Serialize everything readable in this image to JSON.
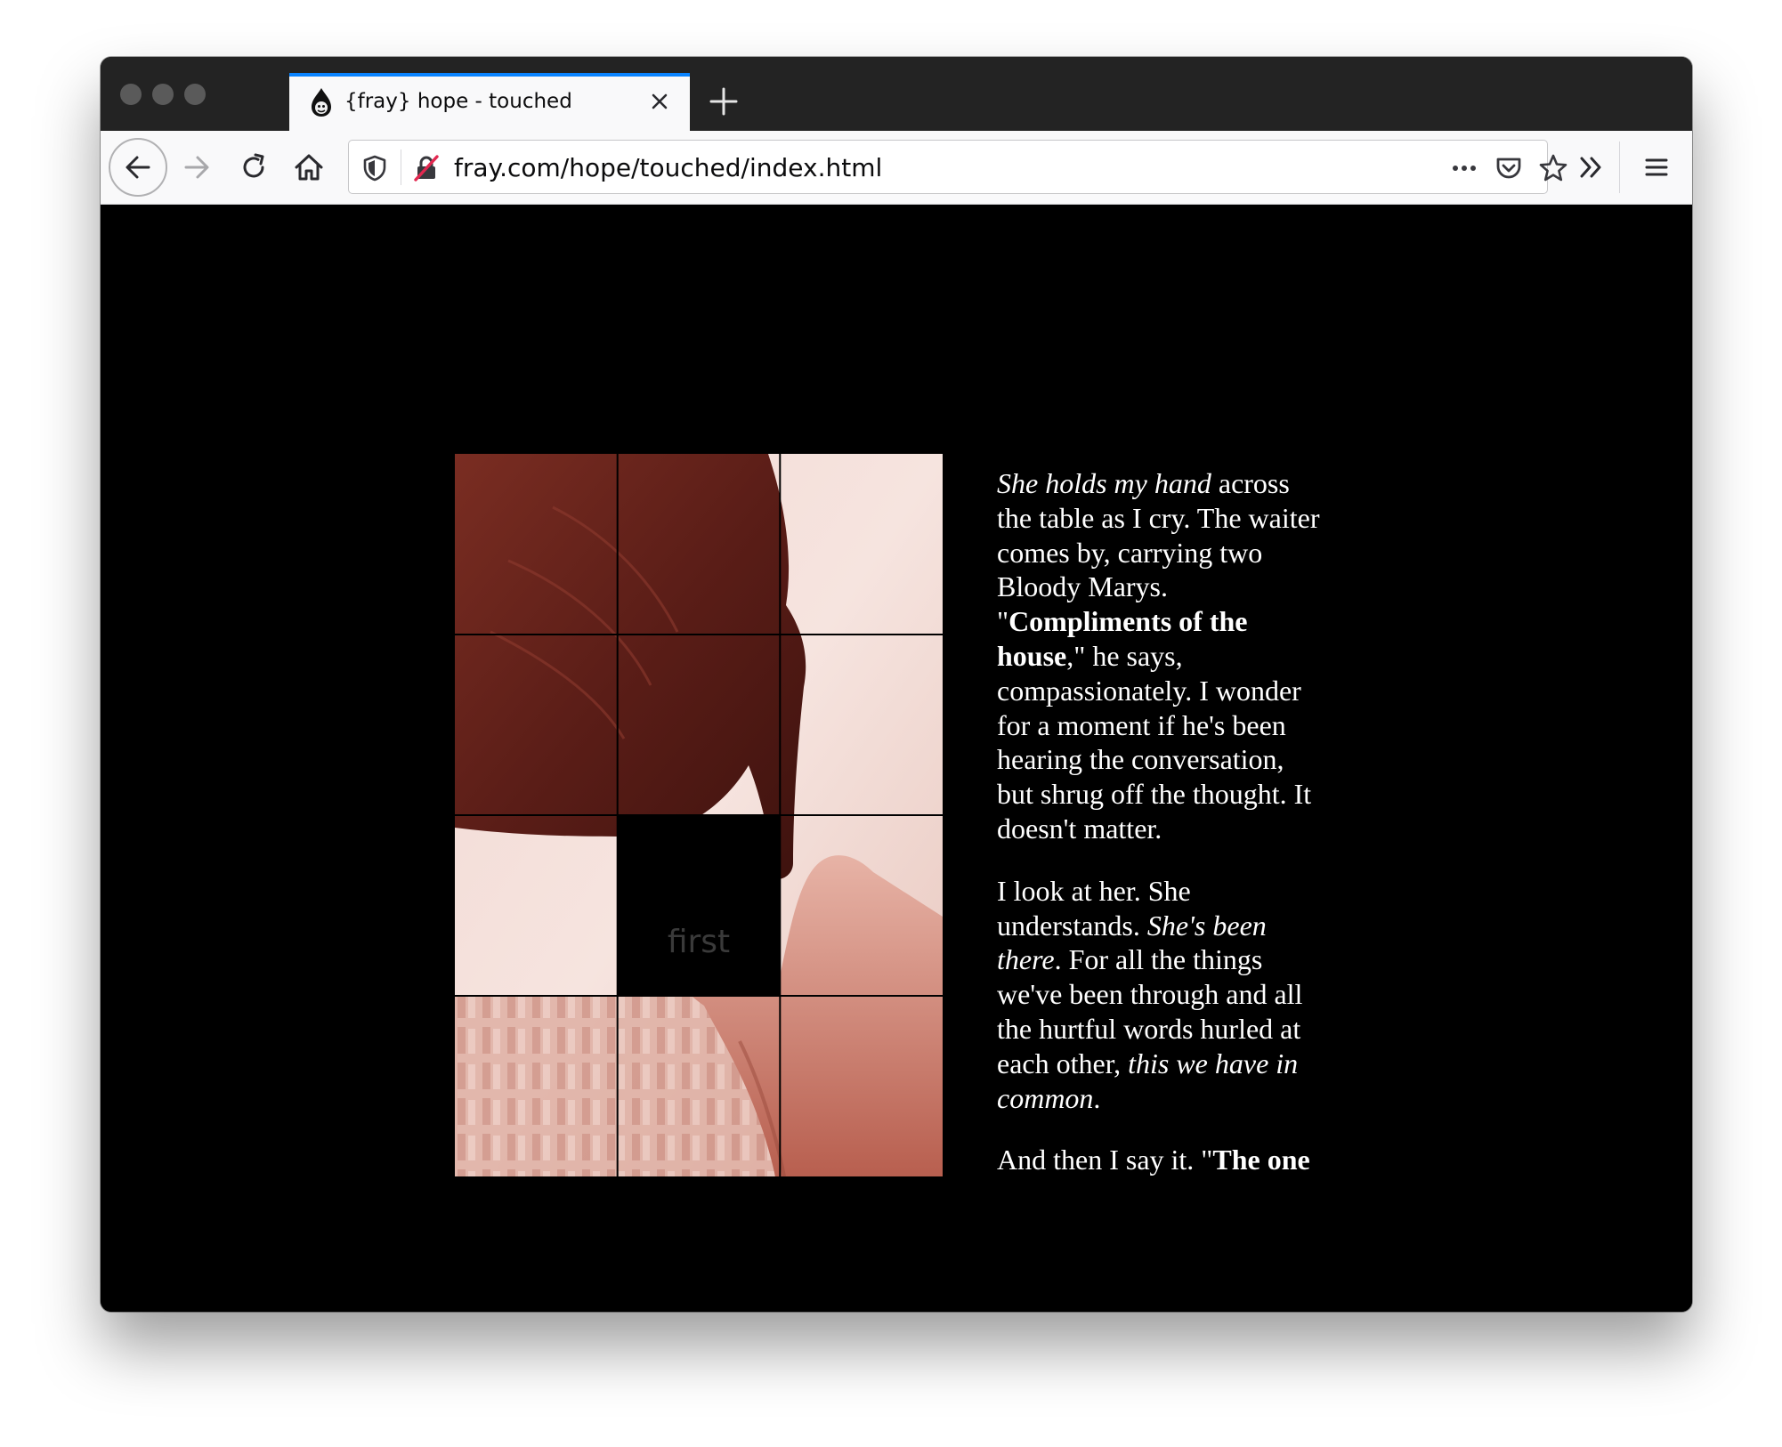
{
  "browser": {
    "tab_title": "{fray} hope - touched",
    "url": "fray.com/hope/touched/index.html",
    "icons": {
      "tab_favicon": "fray-drop-icon",
      "close": "close-icon",
      "new_tab": "plus-icon",
      "back": "back-arrow-icon",
      "forward": "forward-arrow-icon",
      "reload": "reload-icon",
      "home": "home-icon",
      "shield": "tracking-shield-icon",
      "insecure": "insecure-lock-icon",
      "more": "more-actions-icon",
      "pocket": "pocket-icon",
      "bookmark": "star-icon",
      "overflow": "overflow-chevrons-icon",
      "menu": "hamburger-menu-icon"
    }
  },
  "puzzle": {
    "empty_tile_label": "first",
    "rows": 4,
    "cols": 3,
    "empty_tile": {
      "row": 3,
      "col": 2
    }
  },
  "story": {
    "p1": {
      "s1": "She holds my hand",
      "s2": " across the table as I cry. The waiter comes by, carrying two Bloody Marys. \"",
      "s3": "Compliments of the house",
      "s4": ",\" he says, compassionately. I wonder for a moment if he's been hearing the conversation, but shrug off the thought. It doesn't matter."
    },
    "p2": {
      "s1": "I look at her. She understands. ",
      "s2": "She's been there",
      "s3": ". For all the things we've been through and all the hurtful words hurled at each other, ",
      "s4": "this we have in common",
      "s5": "."
    },
    "p3": {
      "s1": "And then I say it. \"",
      "s2": "The one"
    }
  },
  "colors": {
    "page_background": "#000000",
    "toolbar": "#f9f9fa",
    "titlebar": "#232323",
    "tab_accent": "#0a84ff",
    "photo_tint": "#8a3a30"
  }
}
